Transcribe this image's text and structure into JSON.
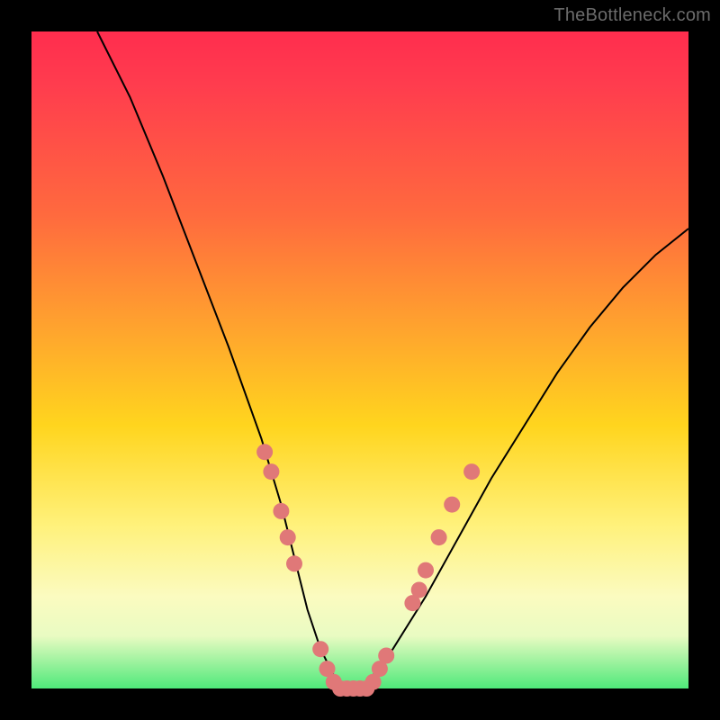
{
  "watermark": "TheBottleneck.com",
  "chart_data": {
    "type": "line",
    "title": "",
    "xlabel": "",
    "ylabel": "",
    "xlim": [
      0,
      100
    ],
    "ylim": [
      0,
      100
    ],
    "series": [
      {
        "name": "bottleneck-curve",
        "x": [
          10,
          15,
          20,
          25,
          30,
          35,
          38,
          40,
          42,
          44,
          46,
          48,
          50,
          52,
          55,
          60,
          65,
          70,
          75,
          80,
          85,
          90,
          95,
          100
        ],
        "values": [
          100,
          90,
          78,
          65,
          52,
          38,
          28,
          20,
          12,
          6,
          2,
          0,
          0,
          2,
          6,
          14,
          23,
          32,
          40,
          48,
          55,
          61,
          66,
          70
        ]
      }
    ],
    "markers": {
      "name": "highlight-dots",
      "color": "#e07878",
      "points": [
        {
          "x": 35.5,
          "y": 36
        },
        {
          "x": 36.5,
          "y": 33
        },
        {
          "x": 38,
          "y": 27
        },
        {
          "x": 39,
          "y": 23
        },
        {
          "x": 40,
          "y": 19
        },
        {
          "x": 44,
          "y": 6
        },
        {
          "x": 45,
          "y": 3
        },
        {
          "x": 46,
          "y": 1
        },
        {
          "x": 47,
          "y": 0
        },
        {
          "x": 48,
          "y": 0
        },
        {
          "x": 49,
          "y": 0
        },
        {
          "x": 50,
          "y": 0
        },
        {
          "x": 51,
          "y": 0
        },
        {
          "x": 52,
          "y": 1
        },
        {
          "x": 53,
          "y": 3
        },
        {
          "x": 54,
          "y": 5
        },
        {
          "x": 58,
          "y": 13
        },
        {
          "x": 59,
          "y": 15
        },
        {
          "x": 60,
          "y": 18
        },
        {
          "x": 62,
          "y": 23
        },
        {
          "x": 64,
          "y": 28
        },
        {
          "x": 67,
          "y": 33
        }
      ]
    }
  }
}
